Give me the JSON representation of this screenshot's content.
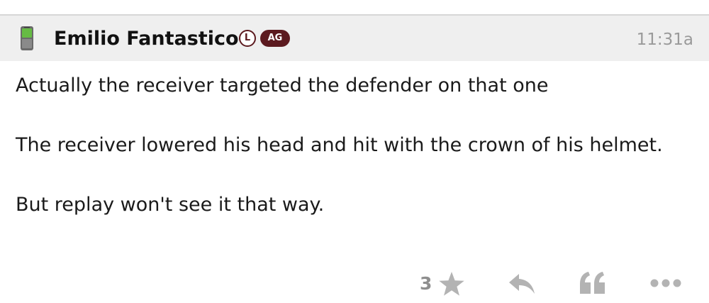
{
  "post": {
    "author": "Emilio Fantastico",
    "badge_l": "L",
    "badge_ag": "AG",
    "timestamp": "11:31a",
    "paragraphs": [
      "Actually the receiver targeted the defender on that one",
      "The receiver lowered his head and hit with the crown of his helmet.",
      "But replay won't see it that way."
    ]
  },
  "actions": {
    "like_count": "3",
    "icons": [
      "star-icon",
      "reply-icon",
      "quote-icon",
      "more-icon"
    ]
  },
  "colors": {
    "header_bg": "#efefef",
    "badge_maroon": "#5c1a1f",
    "icon_gray": "#b3b3b3",
    "timestamp_gray": "#9a9a9a",
    "device_green": "#66bb44"
  }
}
